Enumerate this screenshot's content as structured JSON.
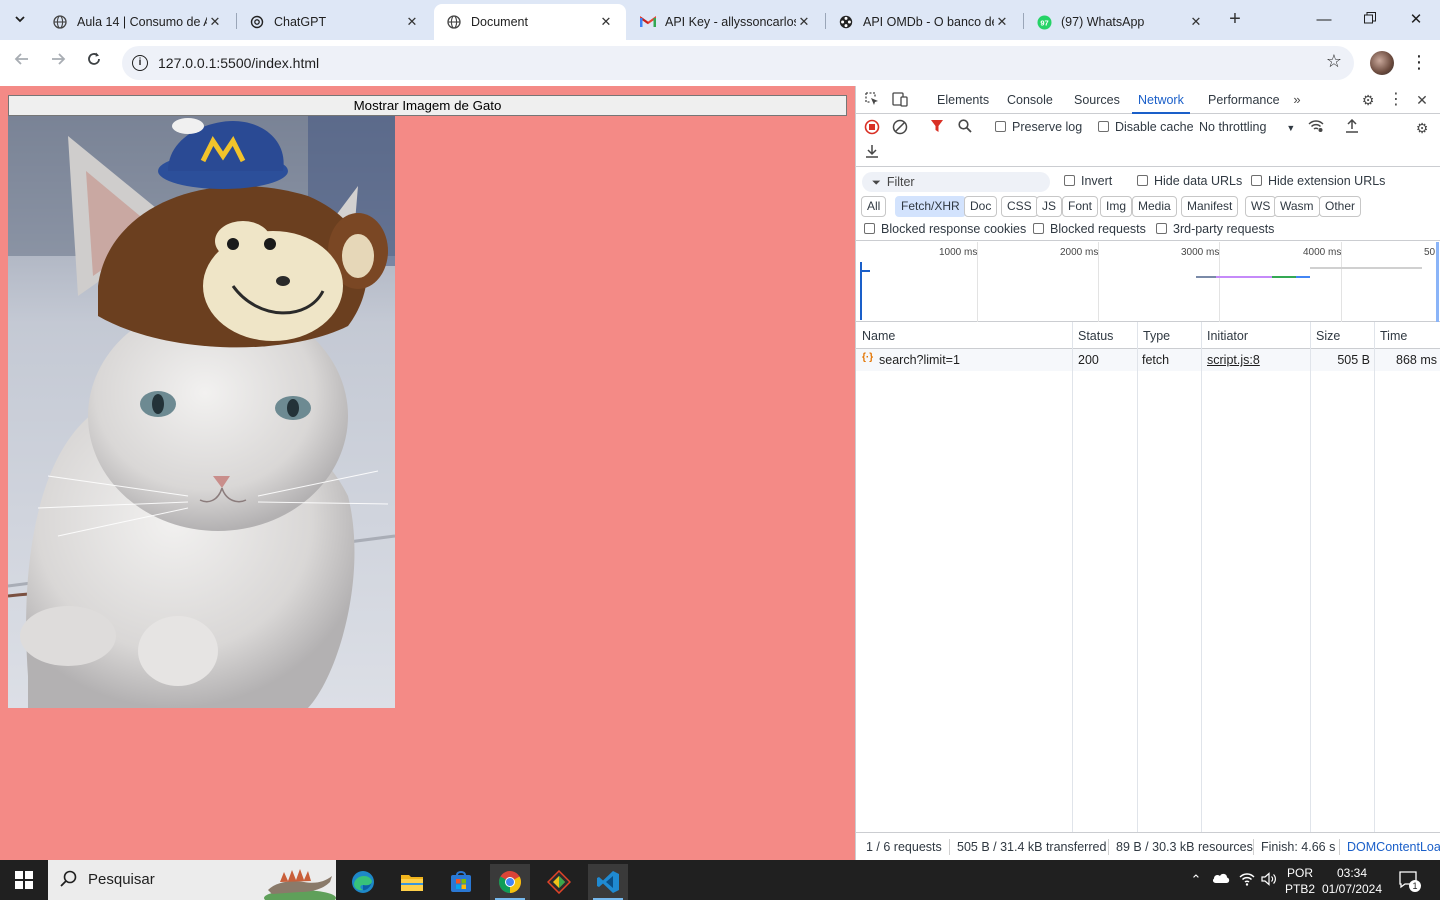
{
  "browser": {
    "tabs": [
      {
        "title": "Aula 14 | Consumo de A",
        "icon": "globe-icon"
      },
      {
        "title": "ChatGPT",
        "icon": "chatgpt-icon"
      },
      {
        "title": "Document",
        "icon": "globe-icon",
        "active": true
      },
      {
        "title": "API Key - allyssoncarlos",
        "icon": "gmail-icon"
      },
      {
        "title": "API OMDb - O banco de",
        "icon": "omdb-icon"
      },
      {
        "title": "(97) WhatsApp",
        "icon": "whatsapp-icon",
        "badge": "97"
      }
    ],
    "url": "127.0.0.1:5500/index.html"
  },
  "page": {
    "button_label": "Mostrar Imagem de Gato",
    "background_color": "#f48a86"
  },
  "devtools": {
    "tabs": [
      "Elements",
      "Console",
      "Sources",
      "Network",
      "Performance"
    ],
    "active_tab": "Network",
    "toolbar": {
      "preserve_log": "Preserve log",
      "disable_cache": "Disable cache",
      "throttling": "No throttling"
    },
    "filter": {
      "placeholder": "Filter",
      "invert": "Invert",
      "hide_data_urls": "Hide data URLs",
      "hide_extension_urls": "Hide extension URLs",
      "types": [
        "All",
        "Fetch/XHR",
        "Doc",
        "CSS",
        "JS",
        "Font",
        "Img",
        "Media",
        "Manifest",
        "WS",
        "Wasm",
        "Other"
      ],
      "active_type": "Fetch/XHR",
      "blocked_response_cookies": "Blocked response cookies",
      "blocked_requests": "Blocked requests",
      "third_party": "3rd-party requests"
    },
    "overview": {
      "ticks": [
        "1000 ms",
        "2000 ms",
        "3000 ms",
        "4000 ms",
        "50"
      ]
    },
    "table": {
      "headers": [
        "Name",
        "Status",
        "Type",
        "Initiator",
        "Size",
        "Time"
      ],
      "rows": [
        {
          "name": "search?limit=1",
          "status": "200",
          "type": "fetch",
          "initiator": "script.js:8",
          "size": "505 B",
          "time": "868 ms"
        }
      ]
    },
    "status": {
      "requests": "1 / 6 requests",
      "transferred": "505 B / 31.4 kB transferred",
      "resources": "89 B / 30.3 kB resources",
      "finish": "Finish: 4.66 s",
      "dcl": "DOMContentLoa"
    }
  },
  "taskbar": {
    "search_placeholder": "Pesquisar",
    "language": "POR",
    "layout": "PTB2",
    "time": "03:34",
    "date": "01/07/2024",
    "notifications": "1"
  }
}
